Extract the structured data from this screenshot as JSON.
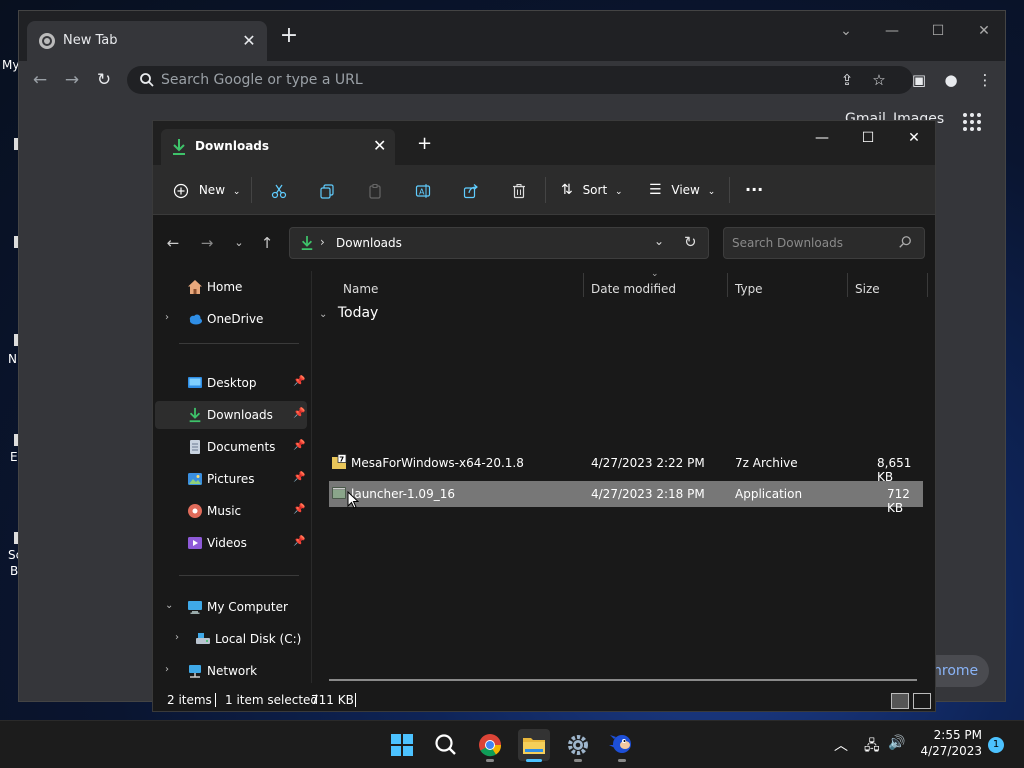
{
  "desktop": {
    "labels": [
      "My",
      "N",
      "E",
      "Sc",
      "B"
    ]
  },
  "chrome": {
    "tab_title": "New Tab",
    "omnibox_placeholder": "Search Google or type a URL",
    "gmail": "Gmail",
    "images": "Images",
    "customize_label": "hrome"
  },
  "explorer": {
    "tab_title": "Downloads",
    "commands": {
      "new": "New",
      "sort": "Sort",
      "view": "View"
    },
    "address": {
      "crumb": "Downloads",
      "search_placeholder": "Search Downloads"
    },
    "nav": {
      "home": "Home",
      "onedrive": "OneDrive",
      "desktop": "Desktop",
      "downloads": "Downloads",
      "documents": "Documents",
      "pictures": "Pictures",
      "music": "Music",
      "videos": "Videos",
      "my_computer": "My Computer",
      "local_disk": "Local Disk (C:)",
      "network": "Network"
    },
    "columns": {
      "name": "Name",
      "date_modified": "Date modified",
      "type": "Type",
      "size": "Size"
    },
    "group": "Today",
    "files": [
      {
        "name": "MesaForWindows-x64-20.1.8",
        "date": "4/27/2023 2:22 PM",
        "type": "7z Archive",
        "size": "8,651 KB"
      },
      {
        "name": "launcher-1.09_16",
        "date": "4/27/2023 2:18 PM",
        "type": "Application",
        "size": "712 KB"
      }
    ],
    "status": {
      "items": "2 items",
      "selected": "1 item selected",
      "size": "711 KB"
    }
  },
  "taskbar": {
    "time": "2:55 PM",
    "date": "4/27/2023",
    "notifications": "1"
  },
  "colors": {
    "accent": "#4cc2ff",
    "downloads_green": "#3ec36a",
    "selection": "#777777"
  }
}
